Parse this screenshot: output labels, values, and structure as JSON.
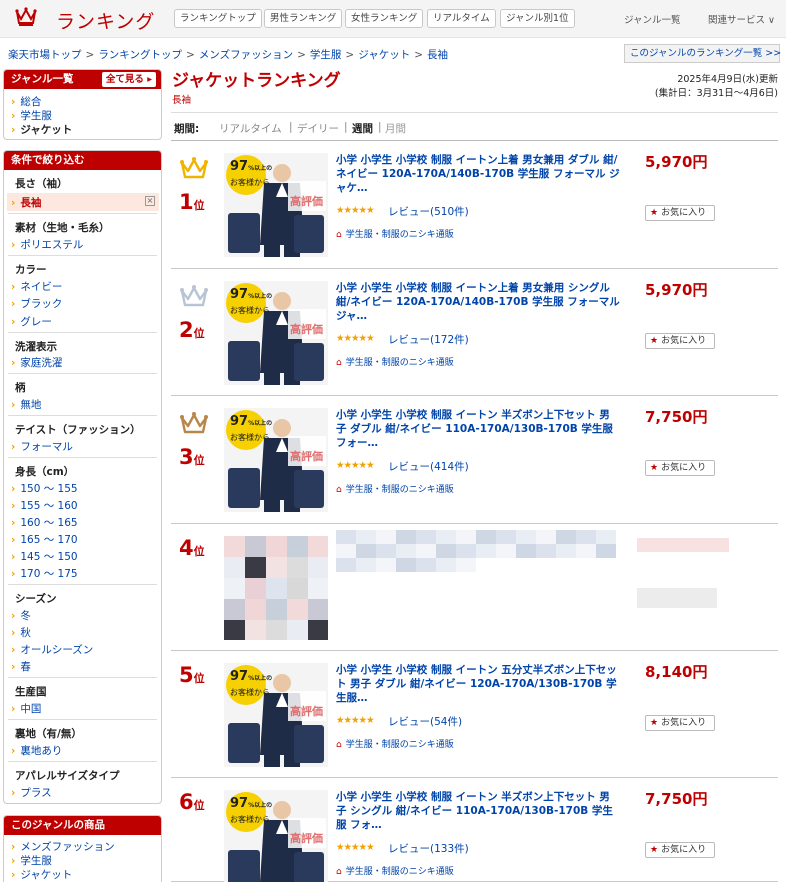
{
  "header": {
    "logo_text": "ランキング",
    "nav": [
      "ランキングトップ",
      "男性ランキング",
      "女性ランキング",
      "リアルタイム",
      "ジャンル別1位"
    ],
    "genre_list": "ジャンル一覧",
    "related": "関連サービス ∨"
  },
  "breadcrumb": [
    "楽天市場トップ",
    "ランキングトップ",
    "メンズファッション",
    "学生服",
    "ジャケット",
    "長袖"
  ],
  "genre_ranking_link": "このジャンルのランキング一覧 >>",
  "sidebar": {
    "genre_title": "ジャンル一覧",
    "see_all": "全て見る",
    "genres": [
      "総合",
      "学生服",
      "ジャケット"
    ],
    "filter_title": "条件で絞り込む",
    "filters": [
      {
        "title": "長さ（袖）",
        "options": [
          "長袖"
        ]
      },
      {
        "title": "素材（生地・毛糸）",
        "options": [
          "ポリエステル"
        ]
      },
      {
        "title": "カラー",
        "options": [
          "ネイビー",
          "ブラック",
          "グレー"
        ]
      },
      {
        "title": "洗濯表示",
        "options": [
          "家庭洗濯"
        ]
      },
      {
        "title": "柄",
        "options": [
          "無地"
        ]
      },
      {
        "title": "テイスト（ファッション）",
        "options": [
          "フォーマル"
        ]
      },
      {
        "title": "身長（cm）",
        "options": [
          "150 〜 155",
          "155 〜 160",
          "160 〜 165",
          "165 〜 170",
          "145 〜 150",
          "170 〜 175"
        ]
      },
      {
        "title": "シーズン",
        "options": [
          "冬",
          "秋",
          "オールシーズン",
          "春"
        ]
      },
      {
        "title": "生産国",
        "options": [
          "中国"
        ]
      },
      {
        "title": "裏地（有/無）",
        "options": [
          "裏地あり"
        ]
      },
      {
        "title": "アパレルサイズタイプ",
        "options": [
          "プラス"
        ]
      }
    ],
    "products_title": "このジャンルの商品",
    "products": [
      "メンズファッション",
      "学生服",
      "ジャケット"
    ]
  },
  "main": {
    "title": "ジャケットランキング",
    "subtitle": "長袖",
    "updated": "2025年4月9日(水)更新",
    "period_range": "(集計日：3月31日〜4月6日)",
    "period_label": "期間:",
    "periods": [
      "リアルタイム",
      "デイリー",
      "週間",
      "月間"
    ],
    "active_period": "週間"
  },
  "items": [
    {
      "rank": "1",
      "suffix": "位",
      "title": "小学 小学生 小学校 制服 イートン上着 男女兼用 ダブル 紺/ネイビー 120A-170A/140B-170B 学生服 フォーマル ジャケ…",
      "price": "5,970円",
      "stars": "★★★★★",
      "reviews": "レビュー(510件)",
      "shop": "学生服・制服のニシキ通販",
      "fav": "お気に入り",
      "thumb_text": "お客様から"
    },
    {
      "rank": "2",
      "suffix": "位",
      "title": "小学 小学生 小学校 制服 イートン上着 男女兼用 シングル 紺/ネイビー 120A-170A/140B-170B 学生服 フォーマル ジャ…",
      "price": "5,970円",
      "stars": "★★★★★",
      "reviews": "レビュー(172件)",
      "shop": "学生服・制服のニシキ通販",
      "fav": "お気に入り",
      "thumb_text": "お客様から"
    },
    {
      "rank": "3",
      "suffix": "位",
      "title": "小学 小学生 小学校 制服 イートン 半ズボン上下セット 男子 ダブル 紺/ネイビー 110A-170A/130B-170B 学生服 フォー…",
      "price": "7,750円",
      "stars": "★★★★★",
      "reviews": "レビュー(414件)",
      "shop": "学生服・制服のニシキ通販",
      "fav": "お気に入り",
      "thumb_text": "お客様から"
    },
    {
      "rank": "4",
      "suffix": "位",
      "blurred": true,
      "price": "7,750円"
    },
    {
      "rank": "5",
      "suffix": "位",
      "title": "小学 小学生 小学校 制服 イートン 五分丈半ズボン上下セット 男子 ダブル 紺/ネイビー 120A-170A/130B-170B 学生服…",
      "price": "8,140円",
      "stars": "★★★★★",
      "reviews": "レビュー(54件)",
      "shop": "学生服・制服のニシキ通販",
      "fav": "お気に入り",
      "thumb_text": "お客様から"
    },
    {
      "rank": "6",
      "suffix": "位",
      "title": "小学 小学生 小学校 制服 イートン 半ズボン上下セット 男子 シングル 紺/ネイビー 110A-170A/130B-170B 学生服 フォ…",
      "price": "7,750円",
      "stars": "★★★★★",
      "reviews": "レビュー(133件)",
      "shop": "学生服・制服のニシキ通販",
      "fav": "お気に入り",
      "thumb_text": "お客様から"
    }
  ],
  "thumb_badge": {
    "big": "97",
    "small": "%以上の",
    "label": "高評価"
  },
  "colors": {
    "brand": "#bf0000",
    "link": "#0044aa",
    "star": "#f0a000"
  }
}
